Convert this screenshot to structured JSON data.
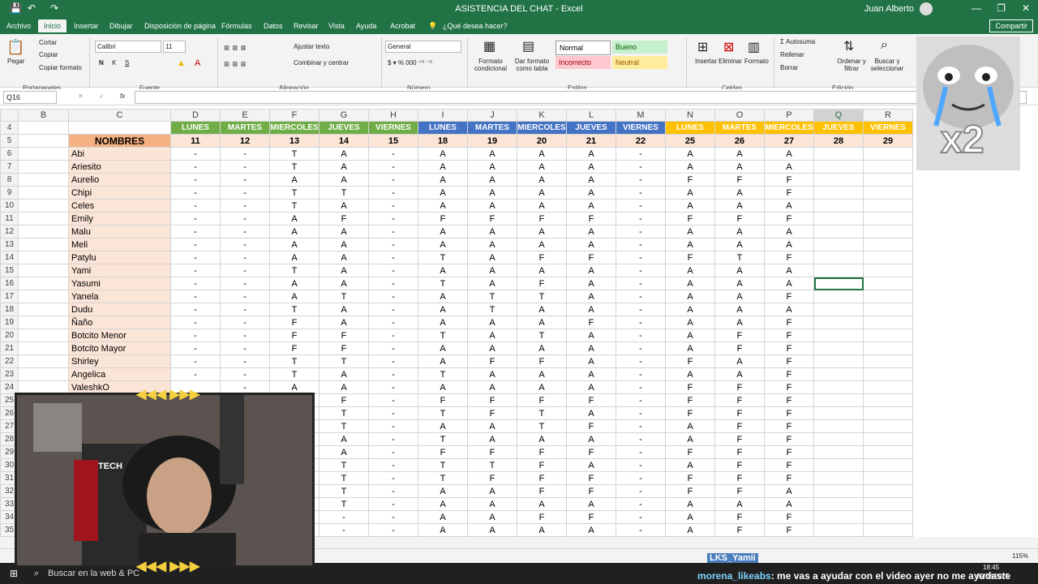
{
  "app": {
    "title": "ASISTENCIA DEL CHAT  -  Excel",
    "user": "Juan Alberto",
    "share_label": "Compartir",
    "tell_me": "¿Qué desea hacer?"
  },
  "tabs": [
    "Archivo",
    "Inicio",
    "Insertar",
    "Dibujar",
    "Disposición de página",
    "Fórmulas",
    "Datos",
    "Revisar",
    "Vista",
    "Ayuda",
    "Acrobat"
  ],
  "ribbon": {
    "clipboard": {
      "paste": "Pegar",
      "cut": "Cortar",
      "copy": "Copiar",
      "copy_format": "Copiar formato",
      "group": "Portapapeles"
    },
    "font": {
      "name": "Calibri",
      "size": "11",
      "bold": "N",
      "italic": "K",
      "underline": "S",
      "group": "Fuente"
    },
    "alignment": {
      "wrap": "Ajustar texto",
      "merge": "Combinar y centrar",
      "group": "Alineación"
    },
    "number": {
      "format": "General",
      "group": "Número"
    },
    "styles": {
      "cond": "Formato condicional",
      "table": "Dar formato como tabla",
      "normal": "Normal",
      "good": "Bueno",
      "bad": "Incorrecto",
      "neutral": "Neutral",
      "group": "Estilos"
    },
    "cells": {
      "insert": "Insertar",
      "delete": "Eliminar",
      "format": "Formato",
      "group": "Celdas"
    },
    "editing": {
      "autosum": "Autosuma",
      "fill": "Rellenar",
      "clear": "Borrar",
      "sort": "Ordenar y filtrar",
      "find": "Buscar y seleccionar",
      "group": "Edición"
    }
  },
  "formula_bar": {
    "cell_ref": "Q16",
    "fx": "fx",
    "value": ""
  },
  "columns": [
    "B",
    "C",
    "D",
    "E",
    "F",
    "G",
    "H",
    "I",
    "J",
    "K",
    "L",
    "M",
    "N",
    "O",
    "P",
    "Q",
    "R"
  ],
  "day_headers": [
    "LUNES",
    "MARTES",
    "MIERCOLES",
    "JUEVES",
    "VIERNES",
    "LUNES",
    "MARTES",
    "MIERCOLES",
    "JUEVES",
    "VIERNES",
    "LUNES",
    "MARTES",
    "MIERCOLES",
    "JUEVES",
    "VIERNES"
  ],
  "day_colors": [
    "#70ad47",
    "#70ad47",
    "#70ad47",
    "#70ad47",
    "#70ad47",
    "#4472c4",
    "#4472c4",
    "#4472c4",
    "#4472c4",
    "#4472c4",
    "#ffc000",
    "#ffc000",
    "#ffc000",
    "#ffc000",
    "#ffc000"
  ],
  "date_numbers": [
    "11",
    "12",
    "13",
    "14",
    "15",
    "18",
    "19",
    "20",
    "21",
    "22",
    "25",
    "26",
    "27",
    "28",
    "29"
  ],
  "names_header": "NOMBRES",
  "rows": [
    {
      "n": "6",
      "name": "Abi",
      "v": [
        "-",
        "-",
        "T",
        "A",
        "-",
        "A",
        "A",
        "A",
        "A",
        "-",
        "A",
        "A",
        "A",
        "",
        ""
      ]
    },
    {
      "n": "7",
      "name": "Ariesito",
      "v": [
        "-",
        "-",
        "T",
        "A",
        "-",
        "A",
        "A",
        "A",
        "A",
        "-",
        "A",
        "A",
        "A",
        "",
        ""
      ]
    },
    {
      "n": "8",
      "name": "Aurelio",
      "v": [
        "-",
        "-",
        "A",
        "A",
        "-",
        "A",
        "A",
        "A",
        "A",
        "-",
        "F",
        "F",
        "F",
        "",
        ""
      ]
    },
    {
      "n": "9",
      "name": "Chipi",
      "v": [
        "-",
        "-",
        "T",
        "T",
        "-",
        "A",
        "A",
        "A",
        "A",
        "-",
        "A",
        "A",
        "F",
        "",
        ""
      ]
    },
    {
      "n": "10",
      "name": "Celes",
      "v": [
        "-",
        "-",
        "T",
        "A",
        "-",
        "A",
        "A",
        "A",
        "A",
        "-",
        "A",
        "A",
        "A",
        "",
        ""
      ]
    },
    {
      "n": "11",
      "name": "Emily",
      "v": [
        "-",
        "-",
        "A",
        "F",
        "-",
        "F",
        "F",
        "F",
        "F",
        "-",
        "F",
        "F",
        "F",
        "",
        ""
      ]
    },
    {
      "n": "12",
      "name": "Malu",
      "v": [
        "-",
        "-",
        "A",
        "A",
        "-",
        "A",
        "A",
        "A",
        "A",
        "-",
        "A",
        "A",
        "A",
        "",
        ""
      ]
    },
    {
      "n": "13",
      "name": "Meli",
      "v": [
        "-",
        "-",
        "A",
        "A",
        "-",
        "A",
        "A",
        "A",
        "A",
        "-",
        "A",
        "A",
        "A",
        "",
        ""
      ]
    },
    {
      "n": "14",
      "name": "Patylu",
      "v": [
        "-",
        "-",
        "A",
        "A",
        "-",
        "T",
        "A",
        "F",
        "F",
        "-",
        "F",
        "T",
        "F",
        "",
        ""
      ]
    },
    {
      "n": "15",
      "name": "Yami",
      "v": [
        "-",
        "-",
        "T",
        "A",
        "-",
        "A",
        "A",
        "A",
        "A",
        "-",
        "A",
        "A",
        "A",
        "",
        ""
      ]
    },
    {
      "n": "16",
      "name": "Yasumi",
      "v": [
        "-",
        "-",
        "A",
        "A",
        "-",
        "T",
        "A",
        "F",
        "A",
        "-",
        "A",
        "A",
        "A",
        "",
        ""
      ]
    },
    {
      "n": "17",
      "name": "Yanela",
      "v": [
        "-",
        "-",
        "A",
        "T",
        "-",
        "A",
        "T",
        "T",
        "A",
        "-",
        "A",
        "A",
        "F",
        "",
        ""
      ]
    },
    {
      "n": "18",
      "name": "Dudu",
      "v": [
        "-",
        "-",
        "T",
        "A",
        "-",
        "A",
        "T",
        "A",
        "A",
        "-",
        "A",
        "A",
        "A",
        "",
        ""
      ]
    },
    {
      "n": "19",
      "name": "Ñaño",
      "v": [
        "-",
        "-",
        "F",
        "A",
        "-",
        "A",
        "A",
        "A",
        "F",
        "-",
        "A",
        "A",
        "F",
        "",
        ""
      ]
    },
    {
      "n": "20",
      "name": "Botcito Menor",
      "v": [
        "-",
        "-",
        "F",
        "F",
        "-",
        "T",
        "A",
        "T",
        "A",
        "-",
        "A",
        "F",
        "F",
        "",
        ""
      ]
    },
    {
      "n": "21",
      "name": "Botcito Mayor",
      "v": [
        "-",
        "-",
        "F",
        "F",
        "-",
        "A",
        "A",
        "A",
        "A",
        "-",
        "A",
        "F",
        "F",
        "",
        ""
      ]
    },
    {
      "n": "22",
      "name": "Shirley",
      "v": [
        "-",
        "-",
        "T",
        "T",
        "-",
        "A",
        "F",
        "F",
        "A",
        "-",
        "F",
        "A",
        "F",
        "",
        ""
      ]
    },
    {
      "n": "23",
      "name": "Angelica",
      "v": [
        "-",
        "-",
        "T",
        "A",
        "-",
        "T",
        "A",
        "A",
        "A",
        "-",
        "A",
        "A",
        "F",
        "",
        ""
      ]
    },
    {
      "n": "24",
      "name": "ValeshkO",
      "v": [
        "",
        "-",
        "A",
        "A",
        "-",
        "A",
        "A",
        "A",
        "A",
        "-",
        "F",
        "F",
        "F",
        "",
        ""
      ]
    },
    {
      "n": "25",
      "name": "",
      "v": [
        "",
        "",
        "",
        "F",
        "-",
        "F",
        "F",
        "F",
        "F",
        "-",
        "F",
        "F",
        "F",
        "",
        ""
      ]
    },
    {
      "n": "26",
      "name": "",
      "v": [
        "",
        "",
        "",
        "T",
        "-",
        "T",
        "F",
        "T",
        "A",
        "-",
        "F",
        "F",
        "F",
        "",
        ""
      ]
    },
    {
      "n": "27",
      "name": "",
      "v": [
        "",
        "",
        "",
        "T",
        "-",
        "A",
        "A",
        "T",
        "F",
        "-",
        "A",
        "F",
        "F",
        "",
        ""
      ]
    },
    {
      "n": "28",
      "name": "",
      "v": [
        "",
        "",
        "",
        "A",
        "-",
        "T",
        "A",
        "A",
        "A",
        "-",
        "A",
        "F",
        "F",
        "",
        ""
      ]
    },
    {
      "n": "29",
      "name": "",
      "v": [
        "",
        "",
        "",
        "A",
        "-",
        "F",
        "F",
        "F",
        "F",
        "-",
        "F",
        "F",
        "F",
        "",
        ""
      ]
    },
    {
      "n": "30",
      "name": "",
      "v": [
        "",
        "",
        "",
        "T",
        "-",
        "T",
        "T",
        "F",
        "A",
        "-",
        "A",
        "F",
        "F",
        "",
        ""
      ]
    },
    {
      "n": "31",
      "name": "",
      "v": [
        "",
        "",
        "",
        "T",
        "-",
        "T",
        "F",
        "F",
        "F",
        "-",
        "F",
        "F",
        "F",
        "",
        ""
      ]
    },
    {
      "n": "32",
      "name": "",
      "v": [
        "",
        "",
        "",
        "T",
        "-",
        "A",
        "A",
        "F",
        "F",
        "-",
        "F",
        "F",
        "A",
        "",
        ""
      ]
    },
    {
      "n": "33",
      "name": "",
      "v": [
        "",
        "",
        "",
        "T",
        "-",
        "A",
        "A",
        "A",
        "A",
        "-",
        "A",
        "A",
        "A",
        "",
        ""
      ]
    },
    {
      "n": "34",
      "name": "",
      "v": [
        "",
        "",
        "",
        "-",
        "-",
        "A",
        "A",
        "F",
        "F",
        "-",
        "A",
        "F",
        "F",
        "",
        ""
      ]
    },
    {
      "n": "35",
      "name": "",
      "v": [
        "",
        "",
        "",
        "-",
        "-",
        "A",
        "A",
        "A",
        "A",
        "-",
        "A",
        "F",
        "F",
        "",
        ""
      ]
    }
  ],
  "status": {
    "zoom": "115%",
    "time": "18:45",
    "date": "09/08/2025"
  },
  "taskbar": {
    "search_placeholder": "Buscar en la web & PC"
  },
  "overlay": {
    "streamer_tag": "LKS_Yamii",
    "chat_user": "morena_likeabs",
    "chat_msg": ": me vas a ayudar con el video ayer no me ayudaste",
    "sticker_text": "x2",
    "webcam_logo": "TECH"
  }
}
